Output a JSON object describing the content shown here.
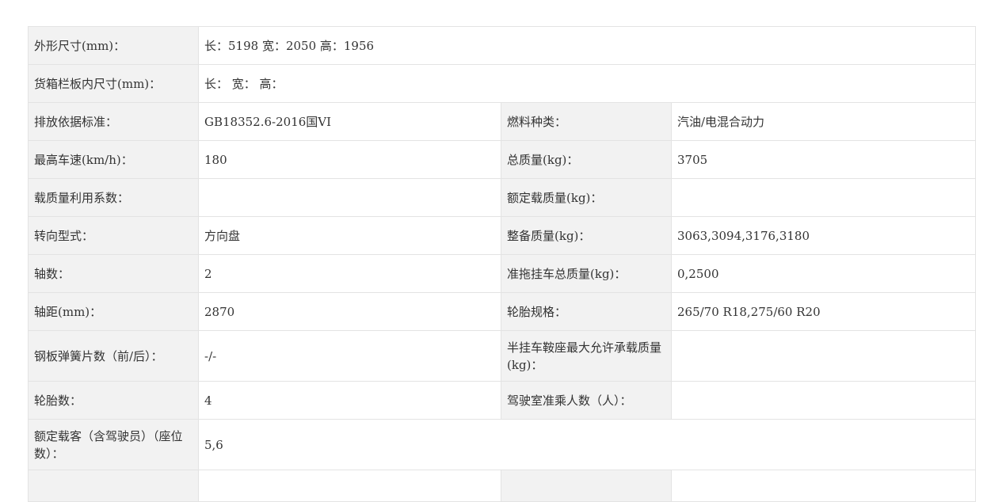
{
  "rows": [
    {
      "label": "外形尺寸(mm)：",
      "value": "长：5198 宽：2050 高：1956"
    },
    {
      "label": "货箱栏板内尺寸(mm)：",
      "value": "长： 宽： 高："
    },
    {
      "label": "排放依据标准：",
      "value": "GB18352.6-2016国VI",
      "label2": "燃料种类：",
      "value2": "汽油/电混合动力"
    },
    {
      "label": "最高车速(km/h)：",
      "value": "180",
      "label2": "总质量(kg)：",
      "value2": "3705"
    },
    {
      "label": "载质量利用系数：",
      "value": "",
      "label2": "额定载质量(kg)：",
      "value2": ""
    },
    {
      "label": "转向型式：",
      "value": "方向盘",
      "label2": "整备质量(kg)：",
      "value2": "3063,3094,3176,3180"
    },
    {
      "label": "轴数：",
      "value": "2",
      "label2": "准拖挂车总质量(kg)：",
      "value2": "0,2500"
    },
    {
      "label": "轴距(mm)：",
      "value": "2870",
      "label2": "轮胎规格：",
      "value2": "265/70 R18,275/60 R20"
    },
    {
      "label": "钢板弹簧片数（前/后）：",
      "value": "-/-",
      "label2": "半挂车鞍座最大允许承载质量(kg)：",
      "value2": ""
    },
    {
      "label": "轮胎数：",
      "value": "4",
      "label2": "驾驶室准乘人数（人）：",
      "value2": ""
    },
    {
      "label": "额定载客（含驾驶员）（座位数）：",
      "value": "5,6"
    }
  ]
}
